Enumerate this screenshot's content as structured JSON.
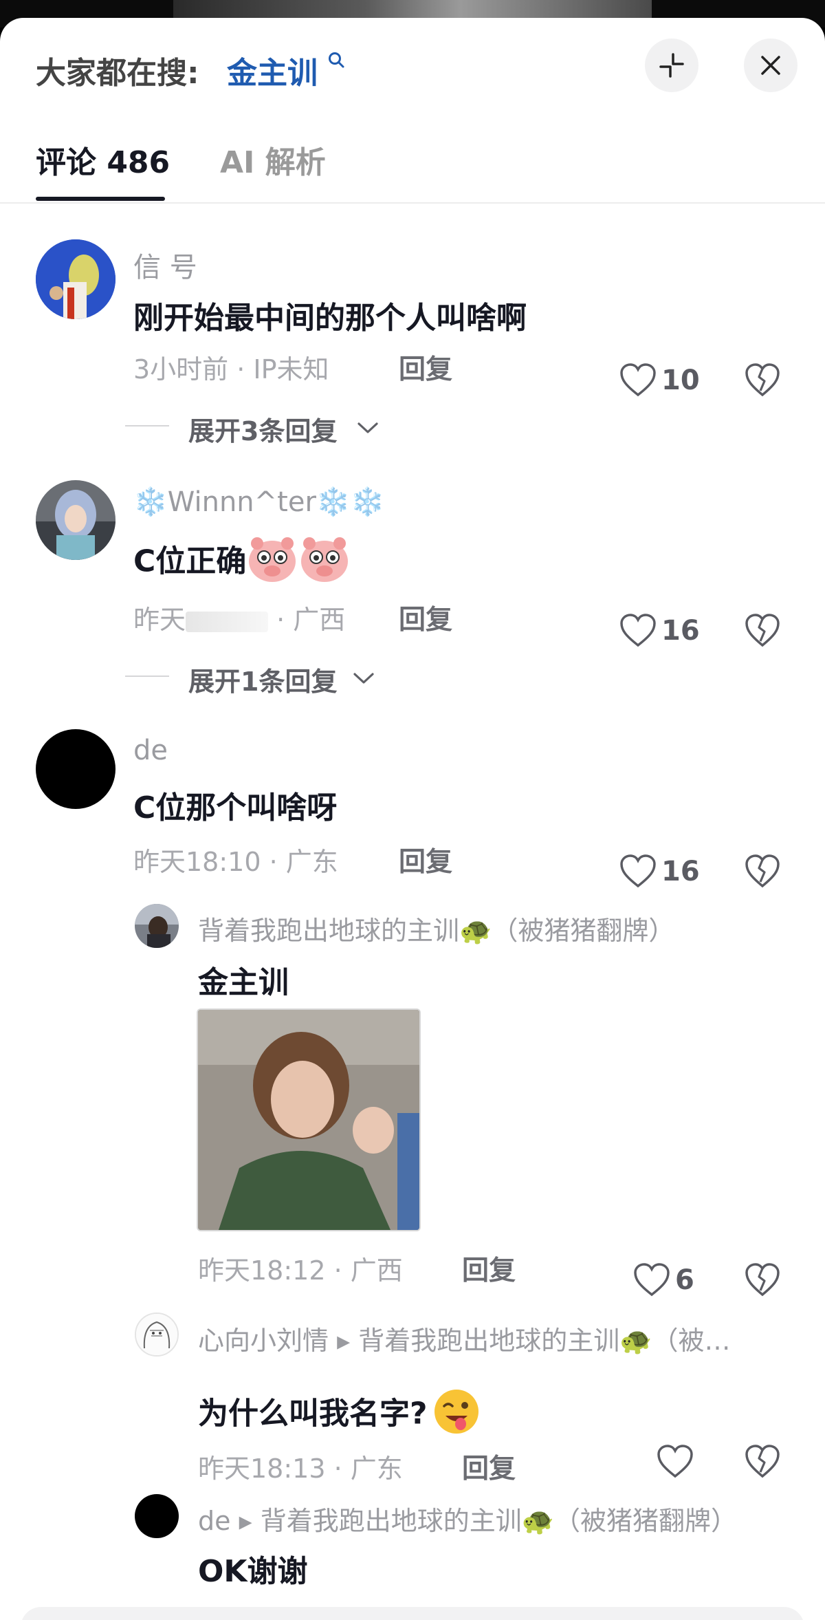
{
  "header": {
    "search_prefix": "大家都在搜:",
    "search_term": "金主训"
  },
  "tabs": [
    {
      "label": "评论 486"
    },
    {
      "label": "AI 解析"
    }
  ],
  "comments": [
    {
      "username": "信 号",
      "text": "刚开始最中间的那个人叫啥啊",
      "meta": "3小时前 · IP未知",
      "reply_label": "回复",
      "likes": "10",
      "expand_label": "展开3条回复"
    },
    {
      "username": "❄️Winnn^ter❄️❄️",
      "text": "C位正确",
      "meta_time": "昨天",
      "meta_loc": "· 广西",
      "reply_label": "回复",
      "likes": "16",
      "expand_label": "展开1条回复"
    },
    {
      "username": "de",
      "text": "C位那个叫啥呀",
      "meta": "昨天18:10 · 广东",
      "reply_label": "回复",
      "likes": "16",
      "replies": [
        {
          "username": "背着我跑出地球的主训🐢（被猪猪翻牌）",
          "text": "金主训",
          "meta": "昨天18:12 · 广西",
          "reply_label": "回复",
          "likes": "6"
        },
        {
          "username": "心向小刘情 ▸ 背着我跑出地球的主训🐢（被…",
          "text": "为什么叫我名字?",
          "meta": "昨天18:13 · 广东",
          "reply_label": "回复",
          "likes": ""
        },
        {
          "username": "de ▸ 背着我跑出地球的主训🐢（被猪猪翻牌）",
          "text": "OK谢谢"
        }
      ]
    }
  ]
}
